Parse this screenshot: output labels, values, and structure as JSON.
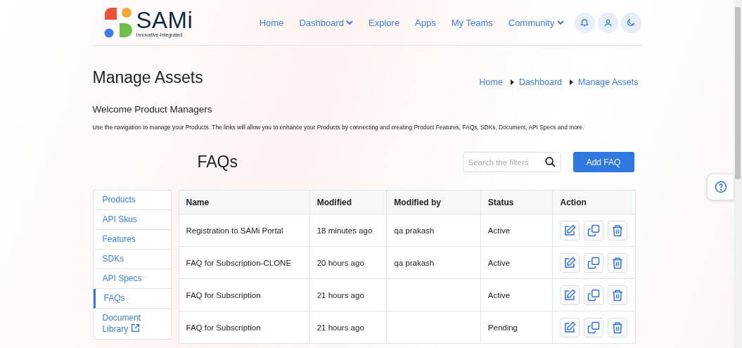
{
  "logo": {
    "name": "SAMi",
    "tagline": "Innovative-Integrated"
  },
  "nav": [
    {
      "label": "Home",
      "kind": "link"
    },
    {
      "label": "Dashboard",
      "kind": "dropdown"
    },
    {
      "label": "Explore",
      "kind": "link"
    },
    {
      "label": "Apps",
      "kind": "link"
    },
    {
      "label": "My Teams",
      "kind": "link"
    },
    {
      "label": "Community",
      "kind": "dropdown"
    }
  ],
  "page": {
    "title": "Manage Assets",
    "breadcrumb": [
      "Home",
      "Dashboard",
      "Manage Assets"
    ],
    "welcome": "Welcome Product Managers",
    "description": "Use the navigation to manage your Products. The links will allow you to enhance your Products by connecting and creating Product Features, FAQs, SDKs, Document, API Specs and more."
  },
  "sidebar": {
    "items": [
      {
        "label": "Products",
        "selected": false,
        "kind": "link"
      },
      {
        "label": "API Skus",
        "selected": false,
        "kind": "link"
      },
      {
        "label": "Features",
        "selected": false,
        "kind": "link"
      },
      {
        "label": "SDKs",
        "selected": false,
        "kind": "link"
      },
      {
        "label": "API Specs",
        "selected": false,
        "kind": "link"
      },
      {
        "label": "FAQs",
        "selected": true,
        "kind": "link"
      },
      {
        "label": "Document Library",
        "selected": false,
        "kind": "external"
      }
    ]
  },
  "section": {
    "title": "FAQs",
    "search": {
      "placeholder": "Search the filters"
    },
    "add_button": "Add FAQ"
  },
  "table": {
    "columns": [
      "Name",
      "Modified",
      "Modified by",
      "Status",
      "Action"
    ],
    "rows": [
      {
        "name": "Registration to SAMi Portal",
        "modified": "18 minutes ago",
        "modified_by": "qa prakash",
        "status": "Active"
      },
      {
        "name": "FAQ for Subscription-CLONE",
        "modified": "20 hours ago",
        "modified_by": "qa prakash",
        "status": "Active"
      },
      {
        "name": "FAQ for Subscription",
        "modified": "21 hours ago",
        "modified_by": "",
        "status": "Active"
      },
      {
        "name": "FAQ for Subscription",
        "modified": "21 hours ago",
        "modified_by": "",
        "status": "Pending"
      }
    ]
  }
}
